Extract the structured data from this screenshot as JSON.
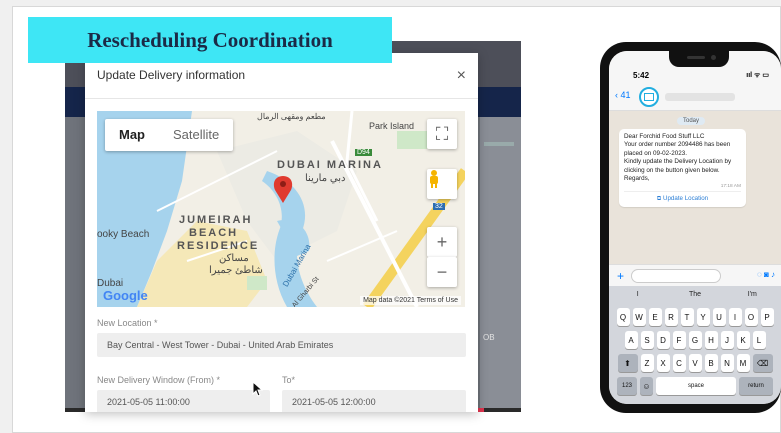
{
  "slide": {
    "title": "Rescheduling Coordination"
  },
  "modal": {
    "title": "Update Delivery information",
    "close": "×",
    "map": {
      "map_tab": "Map",
      "satellite_tab": "Satellite",
      "labels": {
        "park_island": "Park Island",
        "dubai_marina": "DUBAI MARINA",
        "dubai_marina_ar": "دبي مارينا",
        "jumeirah_1": "JUMEIRAH",
        "jumeirah_2": "BEACH",
        "jumeirah_3": "RESIDENCE",
        "jbr_ar_1": "مساكن",
        "jbr_ar_2": "شاطئ جميرا",
        "beach": "ooky Beach",
        "dubai_left": "Dubai",
        "dubai_marina_water": "Dubai Marina",
        "al_gharbi": "Al Gharbi St",
        "road_d94": "D94",
        "road_32": "32",
        "top_ar": "مطعم ومقهى الرمال"
      },
      "google": "Google",
      "attribution": "Map data ©2021   Terms of Use"
    },
    "new_location_label": "New Location *",
    "new_location_value": "Bay Central - West Tower - Dubai - United Arab Emirates",
    "from_label": "New Delivery Window (From) *",
    "from_value": "2021-05-05 11:00:00",
    "to_label": "To*",
    "to_value": "2021-05-05 12:00:00"
  },
  "backdrop": {
    "right_text": "OB"
  },
  "phone": {
    "time": "5:42",
    "status_icons": "ııl ᯤ ▭",
    "back": "‹ 41",
    "day": "Today",
    "message": "Dear Forchid Food Stuff LLC\nYour order number 2094486 has been placed on 09-02-2023.\nKindly update the Delivery Location by clicking on the button given below.\nRegards,",
    "message_time": "17:18 AM",
    "link": "⧉ Update Location",
    "suggestions": [
      "I",
      "The",
      "I'm"
    ],
    "row1": [
      "Q",
      "W",
      "E",
      "R",
      "T",
      "Y",
      "U",
      "I",
      "O",
      "P"
    ],
    "row2": [
      "A",
      "S",
      "D",
      "F",
      "G",
      "H",
      "J",
      "K",
      "L"
    ],
    "row3": [
      "Z",
      "X",
      "C",
      "V",
      "B",
      "N",
      "M"
    ],
    "shift": "⬆",
    "backspace": "⌫",
    "num_key": "123",
    "emoji_key": "☺",
    "space": "space",
    "return": "return"
  }
}
